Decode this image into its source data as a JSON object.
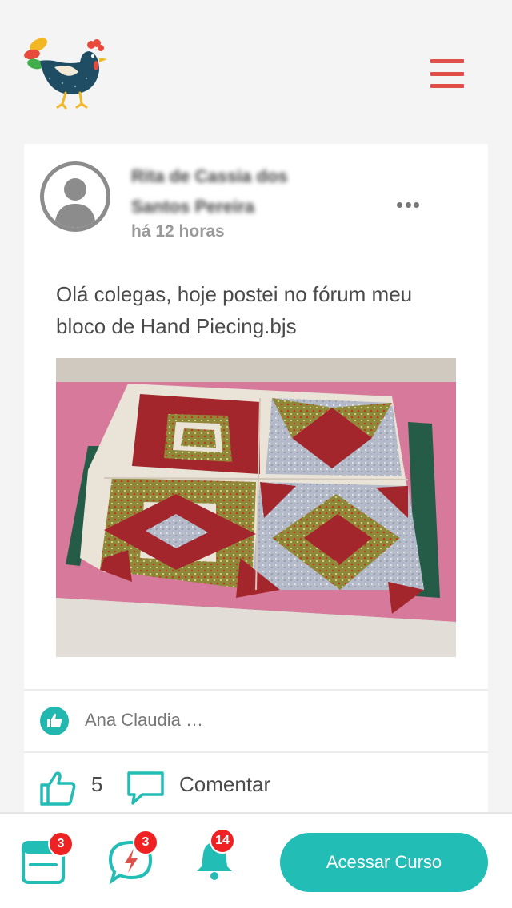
{
  "header": {
    "logo_icon": "rooster-logo-icon",
    "menu_icon": "hamburger-menu-icon"
  },
  "post": {
    "author": "Rita de Cassia dos Santos Pereira",
    "time": "há 12 horas",
    "more_icon": "more-dots-icon",
    "text": "Olá colegas, hoje postei no fórum meu bloco de Hand Piecing.bjs",
    "likers_text": "Ana Claudia …",
    "like_count": "5",
    "comment_label": "Comentar"
  },
  "bottom_bar": {
    "courses_badge": "3",
    "chat_badge": "3",
    "notifications_badge": "14",
    "cta_label": "Acessar Curso"
  },
  "colors": {
    "accent": "#22bdb5",
    "menu": "#e0504a",
    "badge": "#ee2222"
  }
}
